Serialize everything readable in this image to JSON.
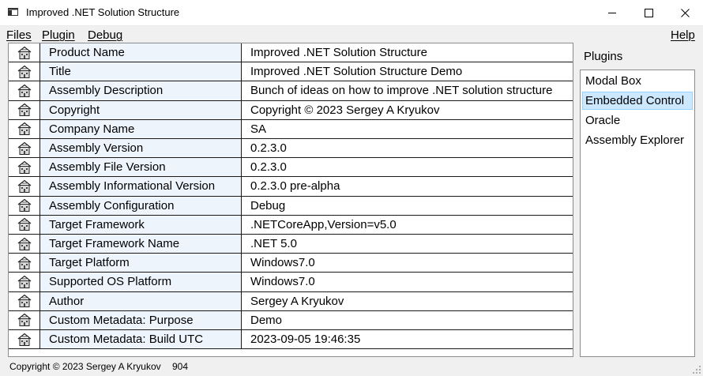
{
  "window": {
    "title": "Improved .NET Solution Structure",
    "app_icon": "window-icon",
    "controls": [
      "minimize-icon",
      "maximize-icon",
      "close-icon"
    ]
  },
  "menu": {
    "files": "Files",
    "plugin": "Plugin",
    "debug": "Debug",
    "help": "Help"
  },
  "grid": {
    "row_icon": "building-icon",
    "rows": [
      {
        "name": "Product Name",
        "value": "Improved .NET Solution Structure"
      },
      {
        "name": "Title",
        "value": "Improved .NET Solution Structure Demo"
      },
      {
        "name": "Assembly Description",
        "value": "Bunch of ideas on how to improve .NET solution structure"
      },
      {
        "name": "Copyright",
        "value": "Copyright © 2023 Sergey A Kryukov"
      },
      {
        "name": "Company Name",
        "value": "SA"
      },
      {
        "name": "Assembly Version",
        "value": "0.2.3.0"
      },
      {
        "name": "Assembly File Version",
        "value": "0.2.3.0"
      },
      {
        "name": "Assembly Informational Version",
        "value": "0.2.3.0 pre-alpha"
      },
      {
        "name": "Assembly Configuration",
        "value": "Debug"
      },
      {
        "name": "Target Framework",
        "value": ".NETCoreApp,Version=v5.0"
      },
      {
        "name": "Target Framework Name",
        "value": ".NET 5.0"
      },
      {
        "name": "Target Platform",
        "value": "Windows7.0"
      },
      {
        "name": "Supported OS Platform",
        "value": "Windows7.0"
      },
      {
        "name": "Author",
        "value": "Sergey A Kryukov"
      },
      {
        "name": "Custom Metadata: Purpose",
        "value": "Demo"
      },
      {
        "name": "Custom Metadata: Build UTC",
        "value": "2023-09-05 19:46:35"
      }
    ]
  },
  "plugins": {
    "label": "Plugins",
    "items": [
      "Modal Box",
      "Embedded Control",
      "Oracle",
      "Assembly Explorer"
    ],
    "selected": "Embedded Control"
  },
  "status": {
    "text": "Copyright © 2023 Sergey A Kryukov",
    "count": "904"
  },
  "colors": {
    "selection_bg": "#cce8ff",
    "selection_border": "#99d1ff",
    "name_cell_bg": "#eef4fc"
  }
}
